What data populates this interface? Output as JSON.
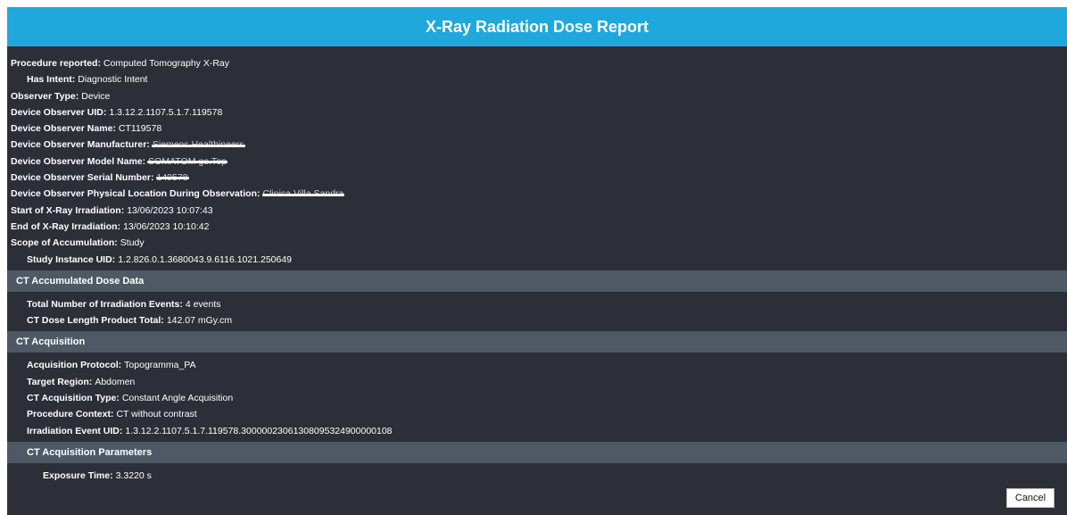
{
  "title": "X-Ray Radiation Dose Report",
  "summary": {
    "procedure_reported": {
      "label": "Procedure reported:",
      "value": "Computed Tomography X-Ray"
    },
    "has_intent": {
      "label": "Has Intent:",
      "value": "Diagnostic Intent"
    },
    "observer_type": {
      "label": "Observer Type:",
      "value": "Device"
    },
    "device_observer_uid": {
      "label": "Device Observer UID:",
      "value": "1.3.12.2.1107.5.1.7.119578"
    },
    "device_observer_name": {
      "label": "Device Observer Name:",
      "value": "CT119578"
    },
    "device_observer_manufacturer": {
      "label": "Device Observer Manufacturer:",
      "value": "Siemens Healthineers"
    },
    "device_observer_model_name": {
      "label": "Device Observer Model Name:",
      "value": "SOMATOM go.Top"
    },
    "device_observer_serial_number": {
      "label": "Device Observer Serial Number:",
      "value": "149578"
    },
    "device_observer_location": {
      "label": "Device Observer Physical Location During Observation:",
      "value": "Clinica Villa Sandra"
    },
    "start_irradiation": {
      "label": "Start of X-Ray Irradiation:",
      "value": "13/06/2023 10:07:43"
    },
    "end_irradiation": {
      "label": "End of X-Ray Irradiation:",
      "value": "13/06/2023 10:10:42"
    },
    "scope_of_accumulation": {
      "label": "Scope of Accumulation:",
      "value": "Study"
    },
    "study_instance_uid": {
      "label": "Study Instance UID:",
      "value": "1.2.826.0.1.3680043.9.6116.1021.250649"
    }
  },
  "accumulated": {
    "heading": "CT Accumulated Dose Data",
    "total_events": {
      "label": "Total Number of Irradiation Events:",
      "value": "4 events"
    },
    "dlp_total": {
      "label": "CT Dose Length Product Total:",
      "value": "142.07 mGy.cm"
    }
  },
  "acquisition": {
    "heading": "CT Acquisition",
    "protocol": {
      "label": "Acquisition Protocol:",
      "value": "Topogramma_PA"
    },
    "target_region": {
      "label": "Target Region:",
      "value": "Abdomen"
    },
    "acq_type": {
      "label": "CT Acquisition Type:",
      "value": "Constant Angle Acquisition"
    },
    "procedure_context": {
      "label": "Procedure Context:",
      "value": "CT without contrast"
    },
    "event_uid": {
      "label": "Irradiation Event UID:",
      "value": "1.3.12.2.1107.5.1.7.119578.30000023061308095324900000108"
    }
  },
  "parameters": {
    "heading": "CT Acquisition Parameters",
    "exposure_time": {
      "label": "Exposure Time:",
      "value": "3.3220 s"
    }
  },
  "buttons": {
    "cancel": "Cancel"
  },
  "colors": {
    "title_bar": "#1fa8dc",
    "background": "#2c2f37",
    "section": "#4e5965"
  }
}
